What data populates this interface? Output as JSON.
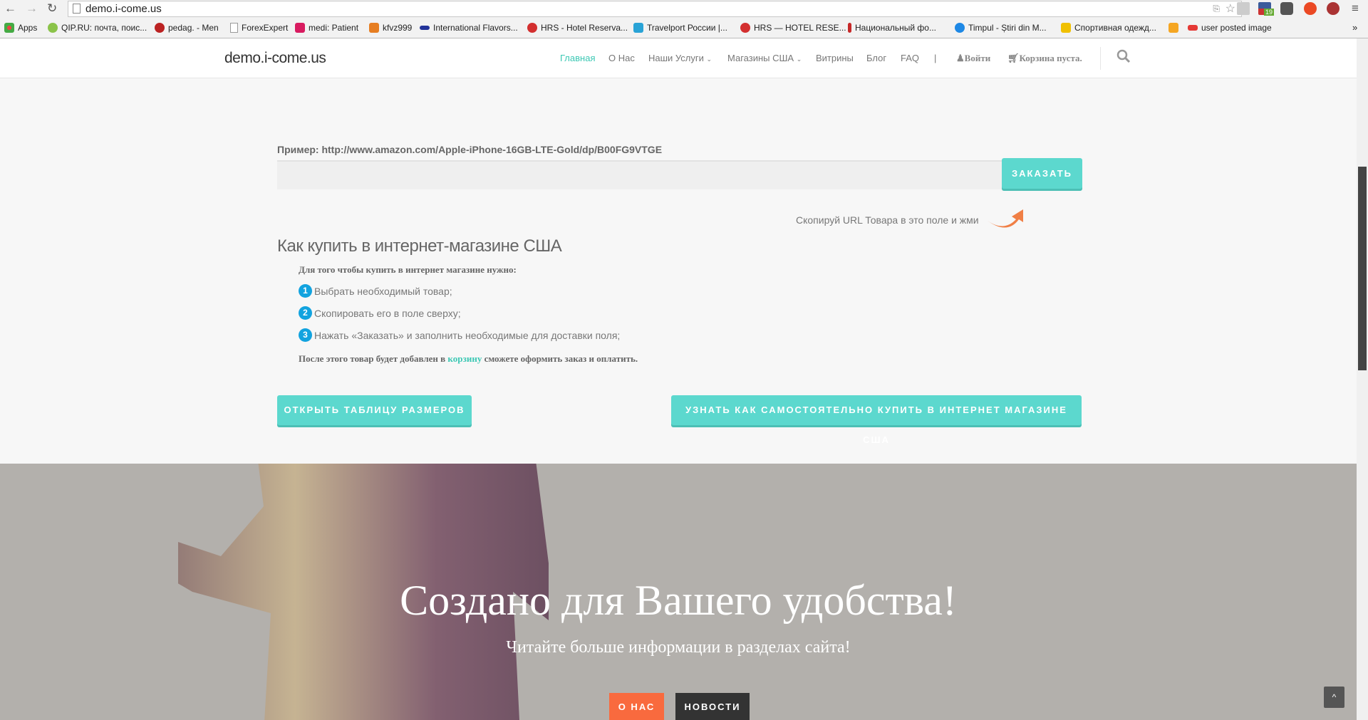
{
  "browser": {
    "url": "demo.i-come.us",
    "badge": "19",
    "bookmarks": [
      {
        "label": "Apps",
        "color": "#4a90d9"
      },
      {
        "label": "QIP.RU: почта, поис...",
        "color": "#8bc34a"
      },
      {
        "label": "pedag. - Men",
        "color": "#b22"
      },
      {
        "label": "ForexExpert",
        "color": "#ddd"
      },
      {
        "label": "medi: Patient",
        "color": "#d81b60"
      },
      {
        "label": "kfvz999",
        "color": "#e67e22"
      },
      {
        "label": "International Flavors...",
        "color": "#223399"
      },
      {
        "label": "HRS - Hotel Reserva...",
        "color": "#d32f2f"
      },
      {
        "label": "Travelport России |...",
        "color": "#29a3d6"
      },
      {
        "label": "HRS — HOTEL RESE...",
        "color": "#d32f2f"
      },
      {
        "label": "Национальный фо...",
        "color": "#c62828"
      },
      {
        "label": "Timpul - Știri din M...",
        "color": "#1e88e5"
      },
      {
        "label": "Спортивная одежд...",
        "color": "#f0c000"
      },
      {
        "label": "",
        "color": "#f5a623"
      },
      {
        "label": "user posted image",
        "color": "#e53935"
      }
    ],
    "more": "»"
  },
  "nav": {
    "logo": "demo.i-come.us",
    "items": [
      "Главная",
      "О Нас",
      "Наши Услуги",
      "Магазины США",
      "Витрины",
      "Блог",
      "FAQ",
      "|"
    ],
    "login": "Войти",
    "cart": "Корзина пуста."
  },
  "order": {
    "example": "Пример: http://www.amazon.com/Apple-iPhone-16GB-LTE-Gold/dp/B00FG9VTGE",
    "input_value": "",
    "button": "ЗАКАЗАТЬ",
    "hint": "Скопируй URL Товара в это поле и жми"
  },
  "howto": {
    "title": "Как купить в интернет-магазине США",
    "intro": "Для того чтобы купить в интернет магазине нужно:",
    "steps": [
      {
        "n": "1",
        "text": "Выбрать необходимый товар;"
      },
      {
        "n": "2",
        "text": "Скопировать его в поле сверху;"
      },
      {
        "n": "3",
        "text": "Нажать «Заказать» и заполнить необходимые для доставки поля;"
      }
    ],
    "after_pre": "После этого товар будет добавлен в ",
    "after_link": "корзину",
    "after_post": " сможете оформить заказ и оплатить.",
    "sizes_button": "ОТКРЫТЬ ТАБЛИЦУ РАЗМЕРОВ",
    "learn_button": "УЗНАТЬ КАК САМОСТОЯТЕЛЬНО КУПИТЬ В ИНТЕРНЕТ МАГАЗИНЕ США"
  },
  "hero": {
    "title": "Создано для Вашего удобства!",
    "subtitle": "Читайте больше информации в разделах сайта!",
    "about_button": "О НАС",
    "news_button": "НОВОСТИ",
    "to_top": "^"
  }
}
